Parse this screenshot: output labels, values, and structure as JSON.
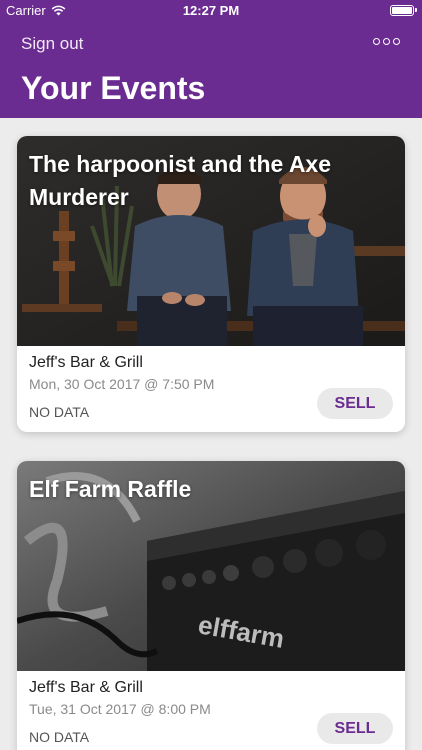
{
  "status_bar": {
    "carrier": "Carrier",
    "time": "12:27 PM"
  },
  "nav": {
    "sign_out": "Sign out",
    "title": "Your Events"
  },
  "events": [
    {
      "title": "The harpoonist and the Axe Murderer",
      "venue": "Jeff's Bar & Grill",
      "date": "Mon, 30 Oct 2017 @ 7:50 PM",
      "status": "NO DATA",
      "action": "SELL"
    },
    {
      "title": "Elf Farm Raffle",
      "venue": "Jeff's Bar & Grill",
      "date": "Tue, 31 Oct 2017 @ 8:00 PM",
      "status": "NO DATA",
      "action": "SELL"
    }
  ],
  "colors": {
    "brand": "#6b2c91",
    "button_bg": "#e9e9e9"
  }
}
